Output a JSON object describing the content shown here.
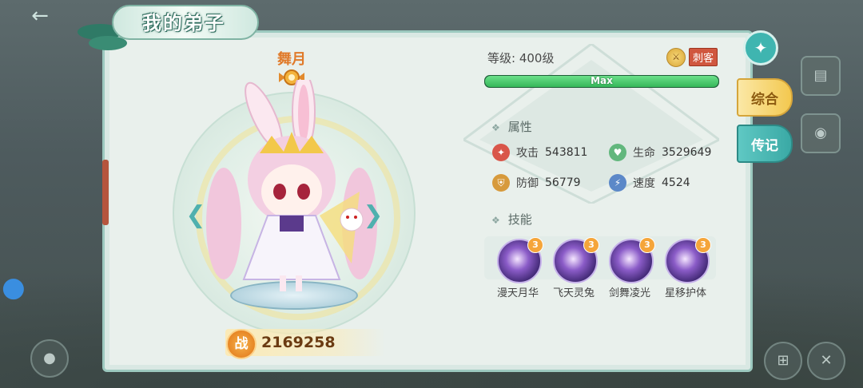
{
  "window": {
    "title": "我的弟子"
  },
  "character": {
    "name": "舞月",
    "level_text": "等级: 400级",
    "class": "刺客",
    "exp_label": "Max",
    "exp_fraction": 1.0,
    "power": "2169258",
    "power_icon": "战"
  },
  "attributes": {
    "title": "属性",
    "items": [
      {
        "label": "攻击",
        "value": "543811",
        "icon": "sword-icon",
        "color": "#d9564a"
      },
      {
        "label": "生命",
        "value": "3529649",
        "icon": "heart-icon",
        "color": "#62b77d"
      },
      {
        "label": "防御",
        "value": "56779",
        "icon": "shield-icon",
        "color": "#d79a3c"
      },
      {
        "label": "速度",
        "value": "4524",
        "icon": "lightning-icon",
        "color": "#5b88c8"
      }
    ]
  },
  "skills": {
    "title": "技能",
    "items": [
      {
        "name": "漫天月华",
        "level": "3"
      },
      {
        "name": "飞天灵兔",
        "level": "3"
      },
      {
        "name": "剑舞凌光",
        "level": "3"
      },
      {
        "name": "星移护体",
        "level": "3"
      }
    ]
  },
  "tabs": [
    {
      "label": "综合",
      "active": true
    },
    {
      "label": "传记",
      "active": false
    }
  ],
  "colors": {
    "accent": "#3fb5b0",
    "name": "#e07a2a",
    "exp": "#35b759",
    "class_badge": "#d0573f"
  }
}
